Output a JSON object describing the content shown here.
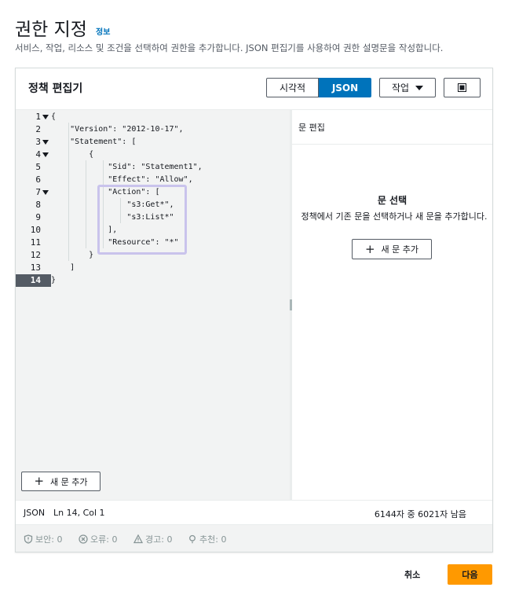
{
  "page": {
    "title": "권한 지정",
    "info_link": "정보",
    "description": "서비스, 작업, 리소스 및 조건을 선택하여 권한을 추가합니다. JSON 편집기를 사용하여 권한 설명문을 작성합니다."
  },
  "editor": {
    "title": "정책 편집기",
    "mode_visual": "시각적",
    "mode_json": "JSON",
    "actions_label": "작업",
    "active_line": 14,
    "lines": [
      {
        "no": "1",
        "text": "{"
      },
      {
        "no": "2",
        "text": "    \"Version\": \"2012-10-17\","
      },
      {
        "no": "3",
        "text": "    \"Statement\": ["
      },
      {
        "no": "4",
        "text": "        {"
      },
      {
        "no": "5",
        "text": "            \"Sid\": \"Statement1\","
      },
      {
        "no": "6",
        "text": "            \"Effect\": \"Allow\","
      },
      {
        "no": "7",
        "text": "            \"Action\": ["
      },
      {
        "no": "8",
        "text": "                \"s3:Get*\","
      },
      {
        "no": "9",
        "text": "                \"s3:List*\""
      },
      {
        "no": "10",
        "text": "            ],"
      },
      {
        "no": "11",
        "text": "            \"Resource\": \"*\""
      },
      {
        "no": "12",
        "text": "        }"
      },
      {
        "no": "13",
        "text": "    ]"
      },
      {
        "no": "14",
        "text": "}"
      }
    ],
    "add_statement_label": "새 문 추가"
  },
  "statement_panel": {
    "header": "문 편집",
    "select_title": "문 선택",
    "select_desc": "정책에서 기존 문을 선택하거나 새 문을 추가합니다.",
    "add_new_label": "새 문 추가"
  },
  "status": {
    "mode": "JSON",
    "position": "Ln 14, Col 1",
    "chars_remaining": "6144자 중 6021자 남음"
  },
  "validation": {
    "security": "보안: 0",
    "errors": "오류: 0",
    "warnings": "경고: 0",
    "suggestions": "추천: 0"
  },
  "footer": {
    "cancel": "취소",
    "next": "다음"
  }
}
